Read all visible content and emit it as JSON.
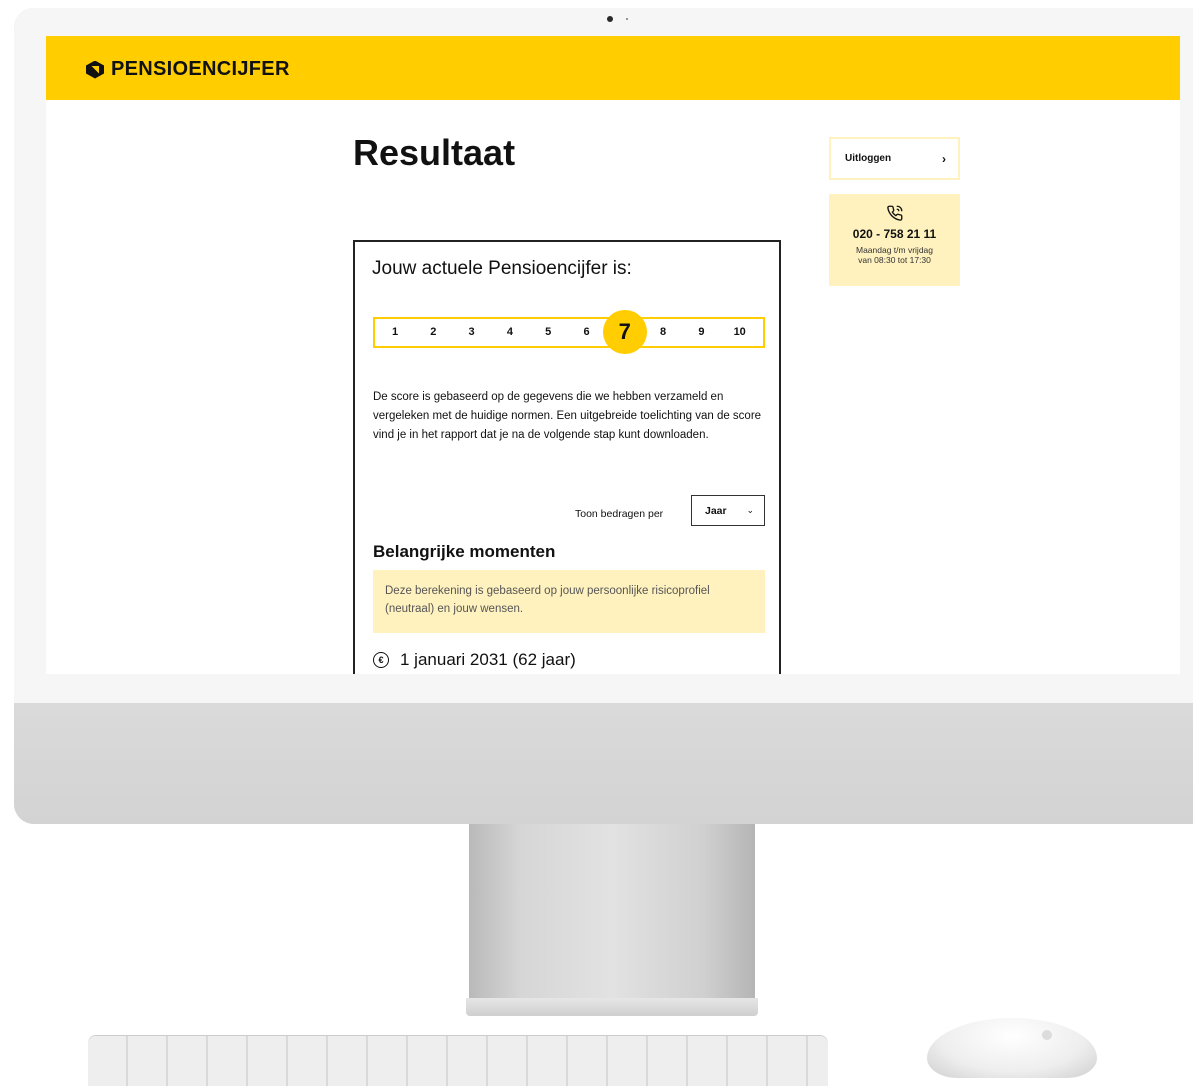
{
  "brand": {
    "name": "PENSIOENCIJFER",
    "accent_color": "#ffcd00",
    "light_accent_color": "#fff2bf"
  },
  "page": {
    "title": "Resultaat"
  },
  "sidebar": {
    "logout_label": "Uitloggen",
    "logout_icon": "chevron-right-icon",
    "contact": {
      "icon": "phone-icon",
      "phone": "020 - 758 21 11",
      "hours_line1": "Maandag t/m vrijdag",
      "hours_line2": "van 08:30 tot 17:30"
    }
  },
  "result": {
    "heading": "Jouw actuele Pensioencijfer is:",
    "score": 7,
    "scale": [
      "1",
      "2",
      "3",
      "4",
      "5",
      "6",
      "7",
      "8",
      "9",
      "10"
    ],
    "description": "De score is gebaseerd op de gegevens die we hebben verzameld en vergeleken met de huidige normen. Een uitgebreide toelichting van de score vind je in het rapport dat je na de volgende stap kunt downloaden.",
    "amount_label": "Toon bedragen per",
    "period_selected": "Jaar",
    "section_title": "Belangrijke momenten",
    "info_text": "Deze berekening is gebaseerd op jouw persoonlijke risicoprofiel (neutraal) en jouw wensen.",
    "moment_icon": "euro-coin-icon",
    "moment_date": "1 januari 2031 (62 jaar)"
  }
}
